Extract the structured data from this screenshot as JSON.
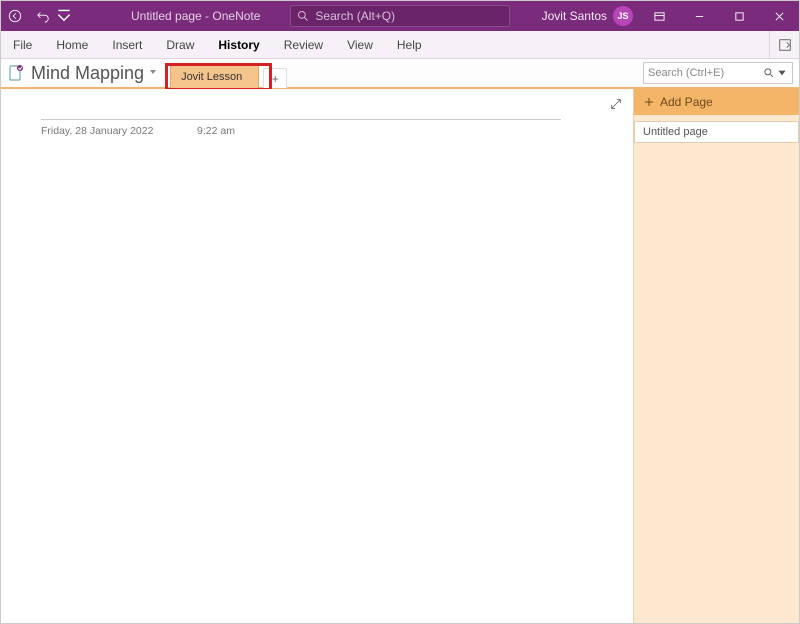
{
  "titlebar": {
    "title": "Untitled page  -  OneNote",
    "search_placeholder": "Search (Alt+Q)",
    "user_name": "Jovit Santos",
    "user_initials": "JS"
  },
  "ribbon": {
    "tabs": [
      "File",
      "Home",
      "Insert",
      "Draw",
      "History",
      "Review",
      "View",
      "Help"
    ],
    "active": "History"
  },
  "notebook": {
    "name": "Mind Mapping",
    "section_tab": "Jovit Lesson",
    "search_placeholder": "Search (Ctrl+E)"
  },
  "page": {
    "date": "Friday, 28 January 2022",
    "time": "9:22 am"
  },
  "sidebar": {
    "add_page_label": "Add Page",
    "pages": [
      "Untitled page"
    ]
  }
}
